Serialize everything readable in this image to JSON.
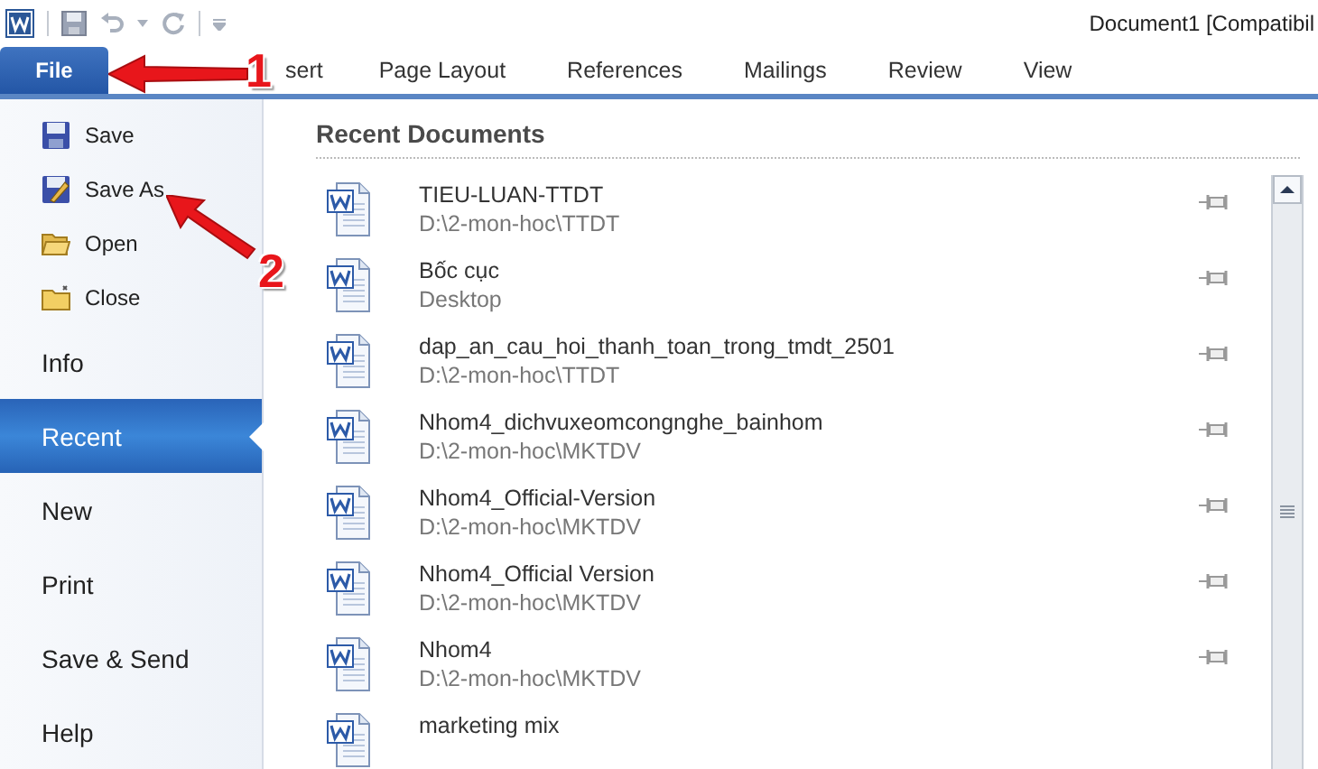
{
  "window": {
    "title": "Document1 [Compatibil"
  },
  "ribbon_tabs": [
    {
      "label": "File",
      "selected": true,
      "kind": "file"
    },
    {
      "label": "sert",
      "selected": false,
      "kind": "tab"
    },
    {
      "label": "Page Layout",
      "selected": false,
      "kind": "tab"
    },
    {
      "label": "References",
      "selected": false,
      "kind": "tab"
    },
    {
      "label": "Mailings",
      "selected": false,
      "kind": "tab"
    },
    {
      "label": "Review",
      "selected": false,
      "kind": "tab"
    },
    {
      "label": "View",
      "selected": false,
      "kind": "tab"
    }
  ],
  "backstage_menu": [
    {
      "label": "Save",
      "kind": "save",
      "selected": false
    },
    {
      "label": "Save As",
      "kind": "saveas",
      "selected": false
    },
    {
      "label": "Open",
      "kind": "open",
      "selected": false
    },
    {
      "label": "Close",
      "kind": "close",
      "selected": false
    },
    {
      "label": "Info",
      "kind": "section",
      "selected": false
    },
    {
      "label": "Recent",
      "kind": "section",
      "selected": true
    },
    {
      "label": "New",
      "kind": "section",
      "selected": false
    },
    {
      "label": "Print",
      "kind": "section",
      "selected": false
    },
    {
      "label": "Save & Send",
      "kind": "section",
      "selected": false
    },
    {
      "label": "Help",
      "kind": "section",
      "selected": false
    }
  ],
  "recent_documents": {
    "title": "Recent Documents",
    "items": [
      {
        "name": "TIEU-LUAN-TTDT",
        "path": "D:\\2-mon-hoc\\TTDT"
      },
      {
        "name": "Bốc cục",
        "path": "Desktop"
      },
      {
        "name": "dap_an_cau_hoi_thanh_toan_trong_tmdt_2501",
        "path": "D:\\2-mon-hoc\\TTDT"
      },
      {
        "name": "Nhom4_dichvuxeomcongnghe_bainhom",
        "path": "D:\\2-mon-hoc\\MKTDV"
      },
      {
        "name": "Nhom4_Official-Version",
        "path": "D:\\2-mon-hoc\\MKTDV"
      },
      {
        "name": "Nhom4_Official Version",
        "path": "D:\\2-mon-hoc\\MKTDV"
      },
      {
        "name": "Nhom4",
        "path": "D:\\2-mon-hoc\\MKTDV"
      },
      {
        "name": "marketing mix"
      }
    ]
  },
  "annotations": [
    {
      "label": "1"
    },
    {
      "label": "2"
    }
  ]
}
